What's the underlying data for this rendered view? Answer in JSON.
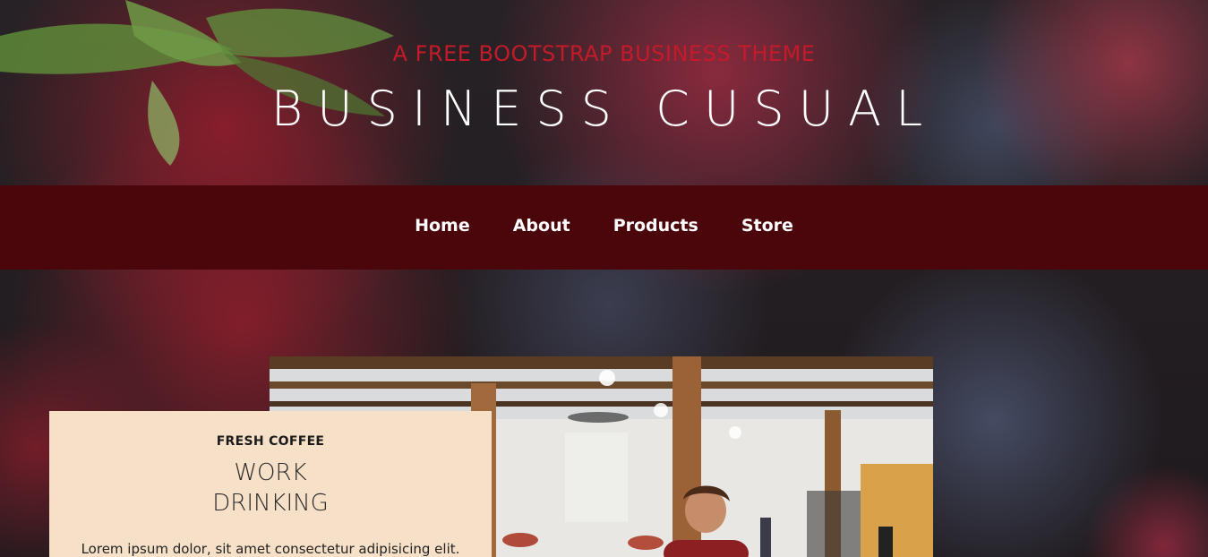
{
  "header": {
    "tagline": "A FREE BOOTSTRAP BUSINESS THEME",
    "site_title": "BUSINESS CUSUAL"
  },
  "nav": {
    "items": [
      {
        "label": "Home"
      },
      {
        "label": "About"
      },
      {
        "label": "Products"
      },
      {
        "label": "Store"
      }
    ]
  },
  "promo": {
    "eyebrow": "FRESH COFFEE",
    "title_line1": "WORK",
    "title_line2": "DRINKING",
    "body": "Lorem ipsum dolor, sit amet consectetur adipisicing elit."
  },
  "colors": {
    "tagline": "#c41a2a",
    "navbar_bg": "#4a060a",
    "promo_bg": "#f6e1c8"
  }
}
